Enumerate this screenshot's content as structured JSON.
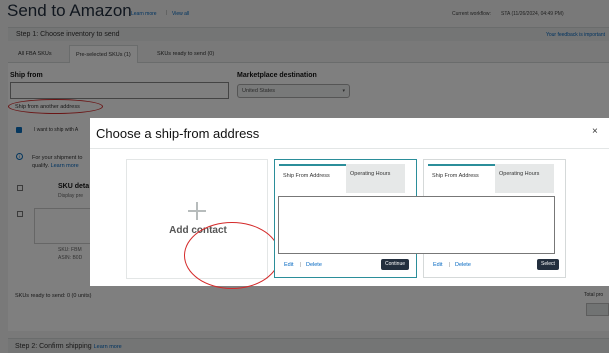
{
  "header": {
    "title": "Send to Amazon",
    "learn_more": "Learn more",
    "view_all": "View all",
    "workflow_label": "Current workflow:",
    "workflow_value": "STA (11/26/2024, 04:49 PM)",
    "feedback": "Your feedback is important"
  },
  "step1": {
    "label": "Step 1: Choose inventory to send",
    "tabs": [
      {
        "label": "All FBA SKUs"
      },
      {
        "label": "Pre-selected SKUs (1)"
      },
      {
        "label": "SKUs ready to send (0)"
      }
    ],
    "ship_from_label": "Ship from",
    "ship_from_value": "",
    "ship_from_other": "Ship from another address",
    "marketplace_label": "Marketplace destination",
    "marketplace_value": "United States",
    "checkbox_text": "I want to ship with A",
    "info_text_1": "For your shipment to",
    "info_text_2": "qualify.",
    "info_learn_more": "Learn more",
    "sku_details": "SKU deta",
    "sku_display": "Display pre",
    "sku_line": "SKU: FBM",
    "asin_line": "ASIN: B0D",
    "ready_to_send": "SKUs ready to send: 0 (0 units)",
    "total_label": "Total pro"
  },
  "step2": {
    "label": "Step 2: Confirm shipping",
    "learn_more": "Learn more"
  },
  "modal": {
    "title": "Choose a ship-from address",
    "close": "×",
    "add_contact": "Add contact",
    "cards": [
      {
        "tab_from": "Ship From Address",
        "tab_hours": "Operating Hours",
        "edit": "Edit",
        "delete": "Delete",
        "button": "Continue"
      },
      {
        "tab_from": "Ship From Address",
        "tab_hours": "Operating Hours",
        "edit": "Edit",
        "delete": "Delete",
        "button": "Select"
      }
    ]
  },
  "colors": {
    "accent_teal": "#2b8e9a",
    "annotation_red": "#d42a2a",
    "button_dark": "#232f3e",
    "link_blue": "#0066c0"
  }
}
